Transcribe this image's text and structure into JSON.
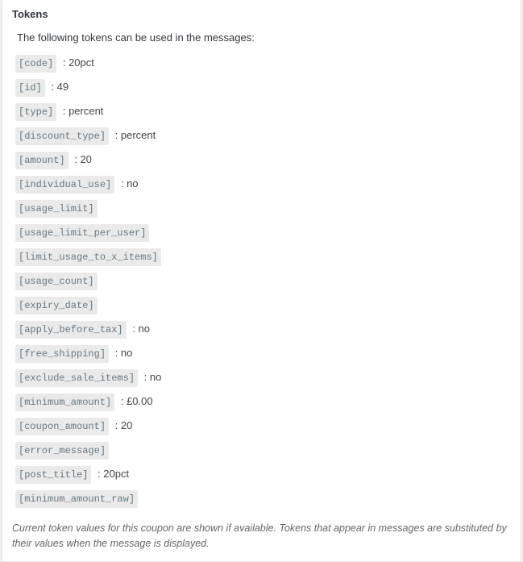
{
  "heading": "Tokens",
  "intro": "The following tokens can be used in the messages:",
  "tokens": [
    {
      "code": "[code]",
      "sep": " : ",
      "value": "20pct"
    },
    {
      "code": "[id]",
      "sep": " : ",
      "value": "49"
    },
    {
      "code": "[type]",
      "sep": " : ",
      "value": "percent"
    },
    {
      "code": "[discount_type]",
      "sep": " : ",
      "value": "percent"
    },
    {
      "code": "[amount]",
      "sep": " : ",
      "value": "20"
    },
    {
      "code": "[individual_use]",
      "sep": " : ",
      "value": "no"
    },
    {
      "code": "[usage_limit]",
      "sep": "",
      "value": ""
    },
    {
      "code": "[usage_limit_per_user]",
      "sep": "",
      "value": ""
    },
    {
      "code": "[limit_usage_to_x_items]",
      "sep": "",
      "value": ""
    },
    {
      "code": "[usage_count]",
      "sep": "",
      "value": ""
    },
    {
      "code": "[expiry_date]",
      "sep": "",
      "value": ""
    },
    {
      "code": "[apply_before_tax]",
      "sep": " : ",
      "value": "no"
    },
    {
      "code": "[free_shipping]",
      "sep": " : ",
      "value": "no"
    },
    {
      "code": "[exclude_sale_items]",
      "sep": " : ",
      "value": "no"
    },
    {
      "code": "[minimum_amount]",
      "sep": " : ",
      "value": "£0.00"
    },
    {
      "code": "[coupon_amount]",
      "sep": " : ",
      "value": "20"
    },
    {
      "code": "[error_message]",
      "sep": "",
      "value": ""
    },
    {
      "code": "[post_title]",
      "sep": " : ",
      "value": "20pct"
    },
    {
      "code": "[minimum_amount_raw]",
      "sep": "",
      "value": ""
    }
  ],
  "footnote": "Current token values for this coupon are shown if available. Tokens that appear in messages are substituted by their values when the message is displayed."
}
